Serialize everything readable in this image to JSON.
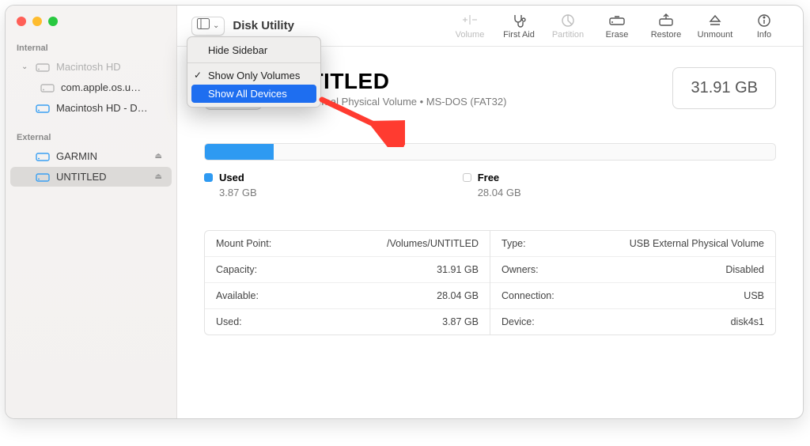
{
  "window": {
    "title": "Disk Utility"
  },
  "sidebar": {
    "groups": [
      {
        "label": "Internal",
        "items": [
          {
            "name": "Macintosh HD",
            "expanded": true,
            "dim": true,
            "color": "#b8b8b8"
          },
          {
            "name": "com.apple.os.u…",
            "child": true,
            "color": "#b8b8b8"
          },
          {
            "name": "Macintosh HD - D…",
            "color": "#3aa0f2"
          }
        ]
      },
      {
        "label": "External",
        "items": [
          {
            "name": "GARMIN",
            "eject": true,
            "color": "#3aa0f2"
          },
          {
            "name": "UNTITLED",
            "eject": true,
            "selected": true,
            "color": "#3aa0f2"
          }
        ]
      }
    ]
  },
  "toolbar": {
    "items": [
      {
        "label": "Volume",
        "active": false,
        "icon": "plus-minus"
      },
      {
        "label": "First Aid",
        "active": true,
        "icon": "stethoscope"
      },
      {
        "label": "Partition",
        "active": false,
        "icon": "pie"
      },
      {
        "label": "Erase",
        "active": true,
        "icon": "erase"
      },
      {
        "label": "Restore",
        "active": true,
        "icon": "restore"
      },
      {
        "label": "Unmount",
        "active": true,
        "icon": "eject"
      },
      {
        "label": "Info",
        "active": true,
        "icon": "info"
      }
    ]
  },
  "volume": {
    "name": "UNTITLED",
    "subtitle": "USB External Physical Volume • MS-DOS (FAT32)",
    "size": "31.91 GB",
    "used_pct": 12
  },
  "legend": {
    "used": {
      "label": "Used",
      "value": "3.87 GB"
    },
    "free": {
      "label": "Free",
      "value": "28.04 GB"
    }
  },
  "details": {
    "left": [
      {
        "k": "Mount Point:",
        "v": "/Volumes/UNTITLED"
      },
      {
        "k": "Capacity:",
        "v": "31.91 GB"
      },
      {
        "k": "Available:",
        "v": "28.04 GB"
      },
      {
        "k": "Used:",
        "v": "3.87 GB"
      }
    ],
    "right": [
      {
        "k": "Type:",
        "v": "USB External Physical Volume"
      },
      {
        "k": "Owners:",
        "v": "Disabled"
      },
      {
        "k": "Connection:",
        "v": "USB"
      },
      {
        "k": "Device:",
        "v": "disk4s1"
      }
    ]
  },
  "menu": {
    "items": [
      {
        "label": "Hide Sidebar",
        "sep_after": true
      },
      {
        "label": "Show Only Volumes",
        "checked": true
      },
      {
        "label": "Show All Devices",
        "selected": true
      }
    ]
  }
}
